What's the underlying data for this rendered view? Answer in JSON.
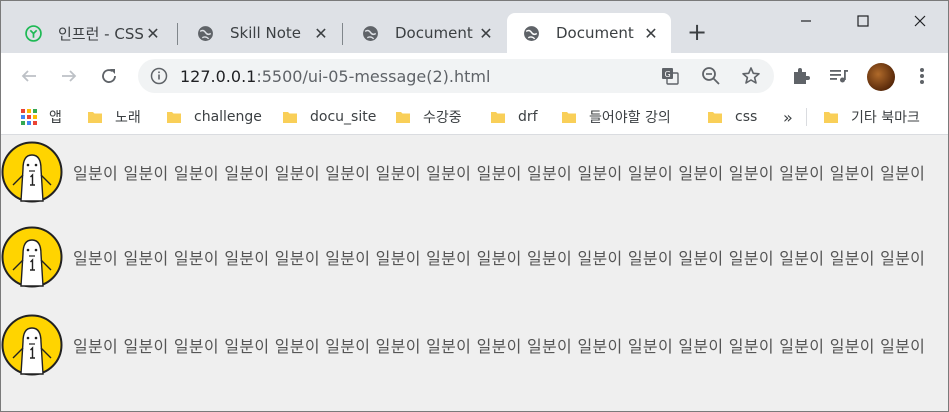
{
  "tabs": [
    {
      "label": "인프런 - CSS",
      "active": false,
      "icon": "inflearn-icon"
    },
    {
      "label": "Skill Note",
      "active": false,
      "icon": "globe-icon"
    },
    {
      "label": "Document",
      "active": false,
      "icon": "globe-icon"
    },
    {
      "label": "Document",
      "active": true,
      "icon": "globe-icon"
    }
  ],
  "omnibox": {
    "url_host": "127.0.0.1",
    "url_rest": ":5500/ui-05-message(2).html"
  },
  "bookmarks": {
    "apps_label": "앱",
    "items": [
      "노래",
      "challenge",
      "docu_site",
      "수강중",
      "drf",
      "들어야할 강의",
      "css"
    ],
    "overflow_label": "»",
    "other_label": "기타 북마크"
  },
  "messages": [
    {
      "text": "일분이 일분이 일분이 일분이 일분이 일분이 일분이 일분이 일분이 일분이 일분이 일분이 일분이 일분이 일분이 일분이 일분이"
    },
    {
      "text": "일분이 일분이 일분이 일분이 일분이 일분이 일분이 일분이 일분이 일분이 일분이 일분이 일분이 일분이 일분이 일분이 일분이"
    },
    {
      "text": "일분이 일분이 일분이 일분이 일분이 일분이 일분이 일분이 일분이 일분이 일분이 일분이 일분이 일분이 일분이 일분이 일분이"
    }
  ],
  "colors": {
    "tabstrip": "#dee1e6",
    "folder": "#f9cf58",
    "avatar_yellow": "#ffd400"
  }
}
